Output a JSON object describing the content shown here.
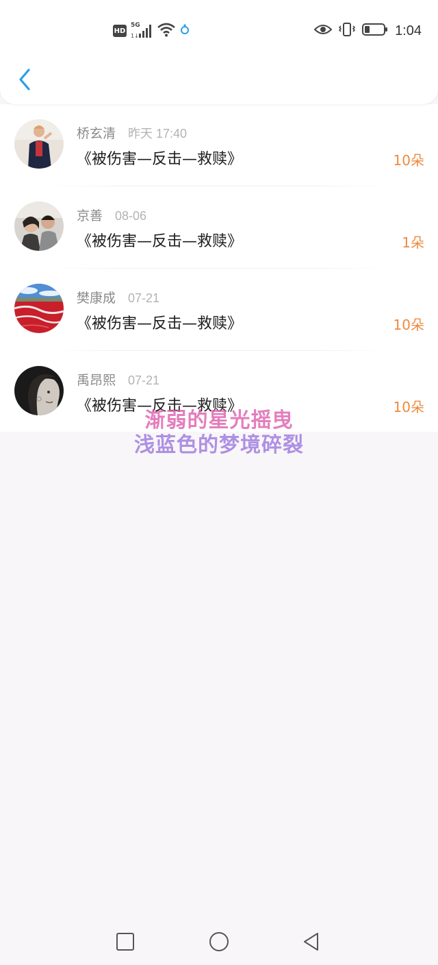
{
  "status_bar": {
    "hd_badge": "HD",
    "network": "5G",
    "time": "1:04"
  },
  "header": {
    "back_icon": "chevron-left-icon"
  },
  "colors": {
    "accent_blue": "#2b9ee8",
    "count_orange": "#ee8a3e"
  },
  "items": [
    {
      "name": "桥玄清",
      "time": "昨天 17:40",
      "title": "《被伤害—反击—救赎》",
      "count": "10朵"
    },
    {
      "name": "京善",
      "time": "08-06",
      "title": "《被伤害—反击—救赎》",
      "count": "1朵"
    },
    {
      "name": "樊康成",
      "time": "07-21",
      "title": "《被伤害—反击—救赎》",
      "count": "10朵"
    },
    {
      "name": "禹昂熙",
      "time": "07-21",
      "title": "《被伤害—反击—救赎》",
      "count": "10朵"
    }
  ],
  "watermark": {
    "line1": "渐弱的星光摇曳",
    "line2": "浅蓝色的梦境碎裂"
  },
  "nav_bar": {
    "recent_icon": "square-icon",
    "home_icon": "circle-icon",
    "back_icon": "triangle-back-icon"
  }
}
